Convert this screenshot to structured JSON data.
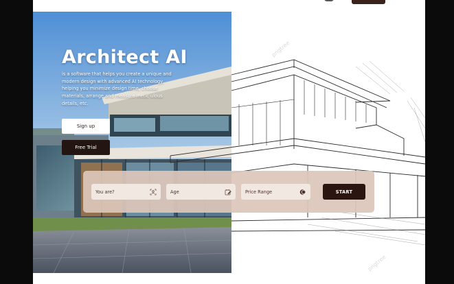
{
  "hero": {
    "title": "Architect AI",
    "description": "is a software that helps you create a unique and modern design with advanced AI technology, helping you minimize design time, choose materials, arrange and measure metic ulous details, etc."
  },
  "actions": {
    "signup_label": "Sign up",
    "trial_label": "Free Trial"
  },
  "search": {
    "fields": [
      {
        "label": "You are?",
        "icon": "person-scan-icon"
      },
      {
        "label": "Age",
        "icon": "calendar-edit-icon"
      },
      {
        "label": "Price Range",
        "icon": "coin-icon"
      }
    ],
    "start_label": "START"
  },
  "watermarks": [
    "pngtree",
    "pngtree"
  ],
  "colors": {
    "primary_dark": "#231512",
    "panel": "#dcc6ba",
    "field": "#f2e8e2",
    "sky": "#6aa0d6"
  }
}
